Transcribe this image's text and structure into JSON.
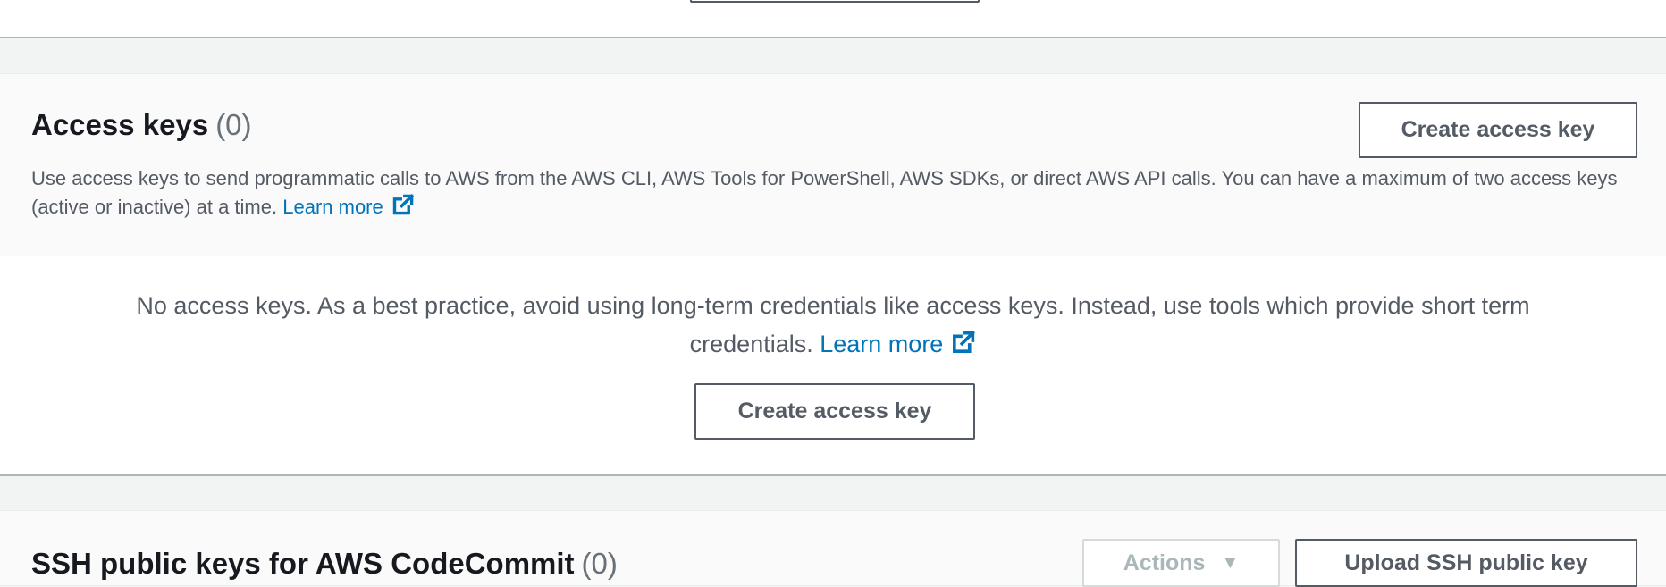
{
  "access_keys": {
    "title": "Access keys",
    "count": "(0)",
    "header_button": "Create access key",
    "description": "Use access keys to send programmatic calls to AWS from the AWS CLI, AWS Tools for PowerShell, AWS SDKs, or direct AWS API calls. You can have a maximum of two access keys (active or inactive) at a time.",
    "learn_more": "Learn more",
    "empty_message": "No access keys. As a best practice, avoid using long-term credentials like access keys. Instead, use tools which provide short term credentials.",
    "empty_learn_more": "Learn more",
    "empty_button": "Create access key"
  },
  "ssh_keys": {
    "title": "SSH public keys for AWS CodeCommit",
    "count": "(0)",
    "actions_button": "Actions",
    "actions_caret": "▼",
    "upload_button": "Upload SSH public key"
  },
  "colors": {
    "link": "#0073bb",
    "button_border": "#545b64",
    "page_background": "#f2f3f3"
  },
  "icons": {
    "external_link": "external-link-icon",
    "dropdown": "caret-down-icon"
  }
}
